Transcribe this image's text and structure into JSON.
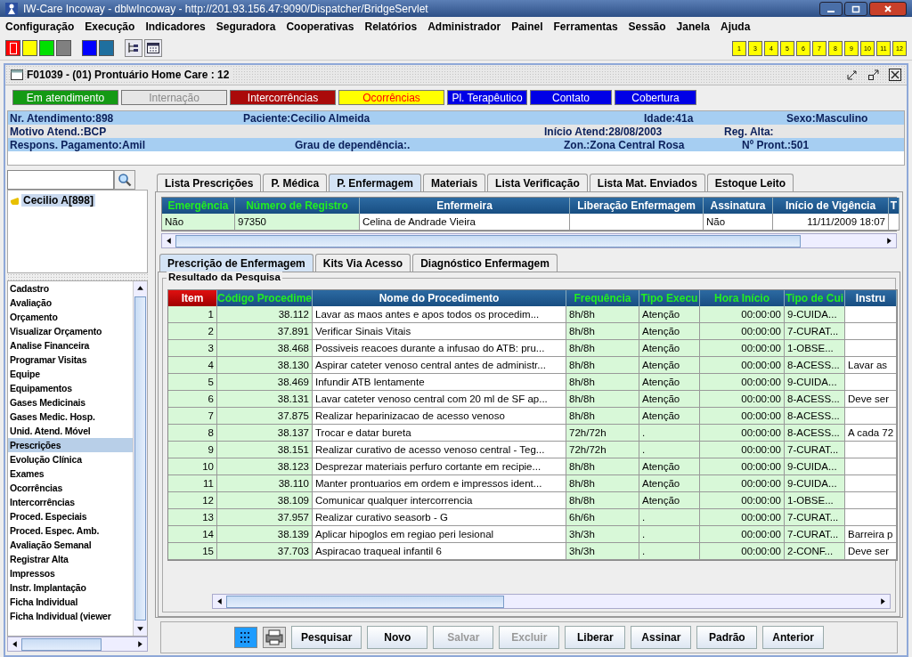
{
  "window": {
    "title": "IW-Care Incoway - dblwIncoway - http://201.93.156.47:9090/Dispatcher/BridgeServlet"
  },
  "menu": [
    "Configuração",
    "Execução",
    "Indicadores",
    "Seguradora",
    "Cooperativas",
    "Relatórios",
    "Administrador",
    "Painel",
    "Ferramentas",
    "Sessão",
    "Janela",
    "Ajuda"
  ],
  "toolbar": {
    "color_buttons": [
      {
        "color": "#ff0000"
      },
      {
        "color": "#ffff00"
      },
      {
        "color": "#00e000"
      },
      {
        "color": "#808080"
      },
      {
        "color": "#0000ff"
      },
      {
        "color": "#1f6f9f"
      }
    ],
    "number_buttons": [
      "1",
      "3",
      "4",
      "5",
      "6",
      "7",
      "8",
      "9",
      "10",
      "11",
      "12"
    ]
  },
  "frame": {
    "title": "F01039 - (01) Prontuário Home Care : 12"
  },
  "status_buttons": [
    {
      "label": "Em atendimento",
      "color": "#149a14",
      "disabled": false
    },
    {
      "label": "Internação",
      "color": "#e6e6e6",
      "disabled": true
    },
    {
      "label": "Intercorrências",
      "color": "#aa0a0a",
      "disabled": false
    },
    {
      "label": "Ocorrências",
      "color": "#ffff00",
      "disabled": false
    },
    {
      "label": "Pl. Terapêutico",
      "color": "#0000e6",
      "disabled": false
    },
    {
      "label": "Contato",
      "color": "#0000e6",
      "disabled": false
    },
    {
      "label": "Cobertura",
      "color": "#0000e6",
      "disabled": false
    }
  ],
  "patient_info": [
    [
      {
        "label": "Nr. Atendimento:",
        "value": "898"
      },
      {
        "label": "Paciente:",
        "value": "Cecilio Almeida"
      },
      {
        "label": "Idade:",
        "value": "41a"
      },
      {
        "label": "Sexo:",
        "value": "Masculino"
      }
    ],
    [
      {
        "label": "Motivo Atend.:",
        "value": "BCP"
      },
      {
        "label": "Início Atend:",
        "value": "28/08/2003"
      },
      {
        "label": "Reg. Alta:"
      }
    ],
    [
      {
        "label": "Respons. Pagamento:",
        "value": "Amil"
      },
      {
        "label": "Grau de dependência:",
        "value": "."
      },
      {
        "label": "Zon.:",
        "value": "Zona Central Rosa"
      },
      {
        "label": "Nº Pront.:",
        "value": "501"
      }
    ]
  ],
  "tree": [
    {
      "label": "Cecilio A[898]",
      "selected": true
    }
  ],
  "sidebar": {
    "items": [
      {
        "label": "Cadastro",
        "selected": false
      },
      {
        "label": "Avaliação",
        "selected": false
      },
      {
        "label": "Orçamento",
        "selected": false
      },
      {
        "label": "Visualizar Orçamento",
        "selected": false
      },
      {
        "label": "Analise Financeira",
        "selected": false
      },
      {
        "label": "Programar Visitas",
        "selected": false
      },
      {
        "label": "Equipe",
        "selected": false
      },
      {
        "label": "Equipamentos",
        "selected": false
      },
      {
        "label": "Gases Medicinais",
        "selected": false
      },
      {
        "label": "Gases Medic. Hosp.",
        "selected": false
      },
      {
        "label": "Unid. Atend. Móvel",
        "selected": false
      },
      {
        "label": "Prescrições",
        "selected": true
      },
      {
        "label": "Evolução Clínica",
        "selected": false
      },
      {
        "label": "Exames",
        "selected": false
      },
      {
        "label": "Ocorrências",
        "selected": false
      },
      {
        "label": "Intercorrências",
        "selected": false
      },
      {
        "label": "Proced. Especiais",
        "selected": false
      },
      {
        "label": "Proced. Espec. Amb.",
        "selected": false
      },
      {
        "label": "Avaliação Semanal",
        "selected": false
      },
      {
        "label": "Registrar Alta",
        "selected": false
      },
      {
        "label": "Impressos",
        "selected": false
      },
      {
        "label": "Instr. Implantação",
        "selected": false
      },
      {
        "label": "Ficha Individual",
        "selected": false
      },
      {
        "label": "Ficha Individual (viewer",
        "selected": false
      }
    ]
  },
  "tabs": [
    {
      "label": "Lista Prescrições",
      "selected": false
    },
    {
      "label": "P. Médica",
      "selected": false
    },
    {
      "label": "P. Enfermagem",
      "selected": true
    },
    {
      "label": "Materiais",
      "selected": false
    },
    {
      "label": "Lista Verificação",
      "selected": false
    },
    {
      "label": "Lista Mat. Enviados",
      "selected": false
    },
    {
      "label": "Estoque Leito",
      "selected": false
    }
  ],
  "nurse_table": {
    "columns": [
      {
        "label": "Emergência",
        "kind": "key",
        "numeric": false
      },
      {
        "label": "Número de Registro",
        "kind": "key",
        "numeric": false
      },
      {
        "label": "Enfermeira",
        "kind": "plain",
        "numeric": false
      },
      {
        "label": "Liberação Enfermagem",
        "kind": "plain"
      },
      {
        "label": "Assinatura",
        "kind": "plain",
        "numeric": false
      },
      {
        "label": "Início de Vigência",
        "kind": "plain",
        "numeric": true
      },
      {
        "label": "T",
        "kind": "plain"
      }
    ],
    "rows": [
      [
        "Não",
        "97350",
        "Celina de Andrade Vieira",
        null,
        "Não",
        "11/11/2009 18:07",
        null
      ]
    ]
  },
  "subtabs": [
    {
      "label": "Prescrição de Enfermagem",
      "selected": true
    },
    {
      "label": "Kits Via Acesso",
      "selected": false
    },
    {
      "label": "Diagnóstico Enfermagem",
      "selected": false
    }
  ],
  "results": {
    "title": "Resultado da Pesquisa",
    "columns": [
      {
        "label": "Item",
        "kind": "index",
        "numeric": true
      },
      {
        "label": "Código Procedime",
        "kind": "key",
        "numeric": true
      },
      {
        "label": "Nome do Procedimento",
        "kind": "plain",
        "numeric": false
      },
      {
        "label": "Frequência",
        "kind": "key",
        "numeric": false
      },
      {
        "label": "Tipo Execu",
        "kind": "key",
        "numeric": false
      },
      {
        "label": "Hora Início",
        "kind": "key",
        "numeric": true
      },
      {
        "label": "Tipo de Cui",
        "kind": "key",
        "numeric": false
      },
      {
        "label": "Instru",
        "kind": "plain",
        "numeric": false
      }
    ],
    "rows": [
      [
        "1",
        "38.112",
        "Lavar as maos antes e apos todos os procedim...",
        "8h/8h",
        "Atenção",
        "00:00:00",
        "9-CUIDA...",
        null
      ],
      [
        "2",
        "37.891",
        "Verificar Sinais Vitais",
        "8h/8h",
        "Atenção",
        "00:00:00",
        "7-CURAT...",
        null
      ],
      [
        "3",
        "38.468",
        "Possiveis reacoes durante a infusao do ATB: pru...",
        "8h/8h",
        "Atenção",
        "00:00:00",
        "1-OBSE...",
        null
      ],
      [
        "4",
        "38.130",
        "Aspirar cateter venoso central antes de administr...",
        "8h/8h",
        "Atenção",
        "00:00:00",
        "8-ACESS...",
        "Lavar as"
      ],
      [
        "5",
        "38.469",
        "Infundir ATB lentamente",
        "8h/8h",
        "Atenção",
        "00:00:00",
        "9-CUIDA...",
        null
      ],
      [
        "6",
        "38.131",
        "Lavar cateter venoso central com 20 ml de SF ap...",
        "8h/8h",
        "Atenção",
        "00:00:00",
        "8-ACESS...",
        "Deve ser"
      ],
      [
        "7",
        "37.875",
        "Realizar heparinizacao de acesso venoso",
        "8h/8h",
        "Atenção",
        "00:00:00",
        "8-ACESS...",
        null
      ],
      [
        "8",
        "38.137",
        "Trocar e datar bureta",
        "72h/72h",
        ".",
        "00:00:00",
        "8-ACESS...",
        "A cada 72"
      ],
      [
        "9",
        "38.151",
        "Realizar curativo de acesso venoso central - Teg...",
        "72h/72h",
        ".",
        "00:00:00",
        "7-CURAT...",
        null
      ],
      [
        "10",
        "38.123",
        "Desprezar materiais perfuro cortante em recipie...",
        "8h/8h",
        "Atenção",
        "00:00:00",
        "9-CUIDA...",
        null
      ],
      [
        "11",
        "38.110",
        "Manter prontuarios em ordem e impressos ident...",
        "8h/8h",
        "Atenção",
        "00:00:00",
        "9-CUIDA...",
        null
      ],
      [
        "12",
        "38.109",
        "Comunicar qualquer intercorrencia",
        "8h/8h",
        "Atenção",
        "00:00:00",
        "1-OBSE...",
        null
      ],
      [
        "13",
        "37.957",
        "Realizar curativo seasorb - G",
        "6h/6h",
        ".",
        "00:00:00",
        "7-CURAT...",
        null
      ],
      [
        "14",
        "38.139",
        "Aplicar hipoglos em regiao peri lesional",
        "3h/3h",
        ".",
        "00:00:00",
        "7-CURAT...",
        "Barreira p"
      ],
      [
        "15",
        "37.703",
        "Aspiracao traqueal infantil 6",
        "3h/3h",
        ".",
        "00:00:00",
        "2-CONF...",
        "Deve ser"
      ]
    ]
  },
  "buttons": [
    {
      "label": "Pesquisar",
      "disabled": false
    },
    {
      "label": "Novo",
      "disabled": false
    },
    {
      "label": "Salvar",
      "disabled": true
    },
    {
      "label": "Excluir",
      "disabled": true
    },
    {
      "label": "Liberar",
      "disabled": false
    },
    {
      "label": "Assinar",
      "disabled": false
    },
    {
      "label": "Padrão",
      "disabled": false
    },
    {
      "label": "Anterior",
      "disabled": false
    }
  ]
}
